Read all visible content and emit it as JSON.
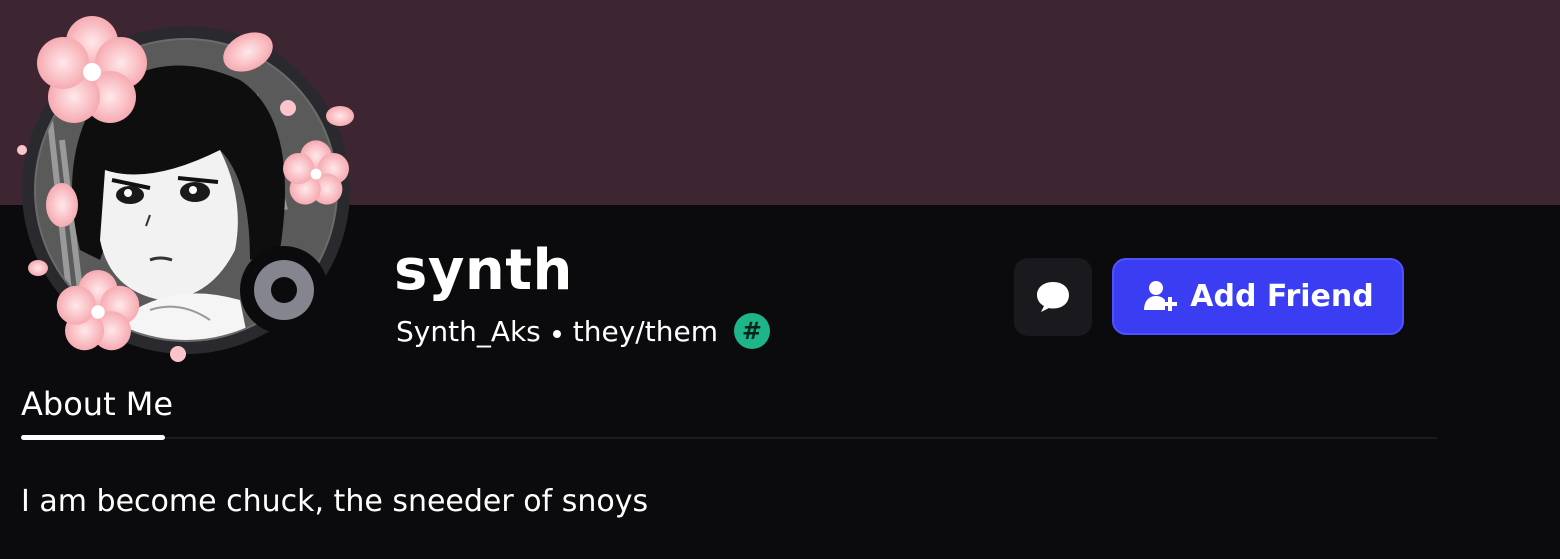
{
  "profile": {
    "display_name": "synth",
    "username": "Synth_Aks",
    "pronouns": "they/them",
    "badge_symbol": "#",
    "status": "offline",
    "avatar_description_icon": "avatar-anime-girl-with-cherry-blossoms"
  },
  "actions": {
    "message_icon": "chat-bubble-icon",
    "add_friend_label": "Add Friend",
    "add_friend_icon": "add-user-icon"
  },
  "tabs": [
    {
      "label": "About Me",
      "active": true
    }
  ],
  "about": {
    "text": "I am become chuck, the sneeder of snoys"
  },
  "colors": {
    "banner": "#3d2631",
    "background": "#0b0b0d",
    "accent": "#3a3df1",
    "badge": "#1fb58a",
    "status_offline": "#84858f"
  }
}
